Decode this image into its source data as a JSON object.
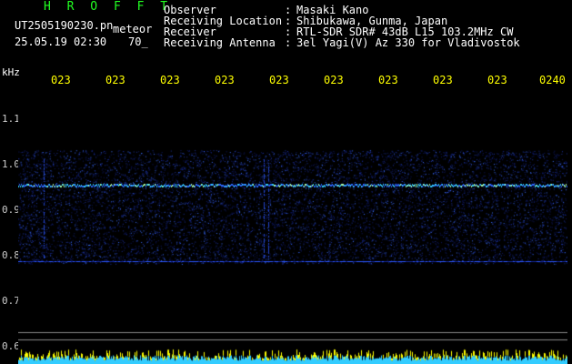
{
  "header": {
    "brand": "H R O F F T",
    "file_name": "UT2505190230.pn",
    "event_type": "meteor",
    "date_time": "25.05.19 02:30",
    "level": "70_"
  },
  "info": [
    {
      "label": "Observer",
      "value": "Masaki Kano"
    },
    {
      "label": "Receiving Location",
      "value": "Shibukawa, Gunma, Japan"
    },
    {
      "label": "Receiver",
      "value": "RTL-SDR SDR# 43dB L15 103.2MHz CW"
    },
    {
      "label": "Receiving Antenna",
      "value": "3el Yagi(V) Az 330 for Vladivostok"
    }
  ],
  "separator": ":",
  "axis": {
    "unit": "kHz",
    "time_ticks": [
      "023",
      "023",
      "023",
      "023",
      "023",
      "023",
      "023",
      "023",
      "023",
      "0240"
    ],
    "freq_ticks": [
      "1.1",
      "1.0",
      "0.9",
      "0.8",
      "0.7",
      "0.6"
    ]
  },
  "colors": {
    "brand": "#22ff22",
    "ticks": "#ffff00",
    "signal_line": "#33ccff",
    "strip_cyan": "#33ccff",
    "strip_yellow": "#ffff00"
  }
}
